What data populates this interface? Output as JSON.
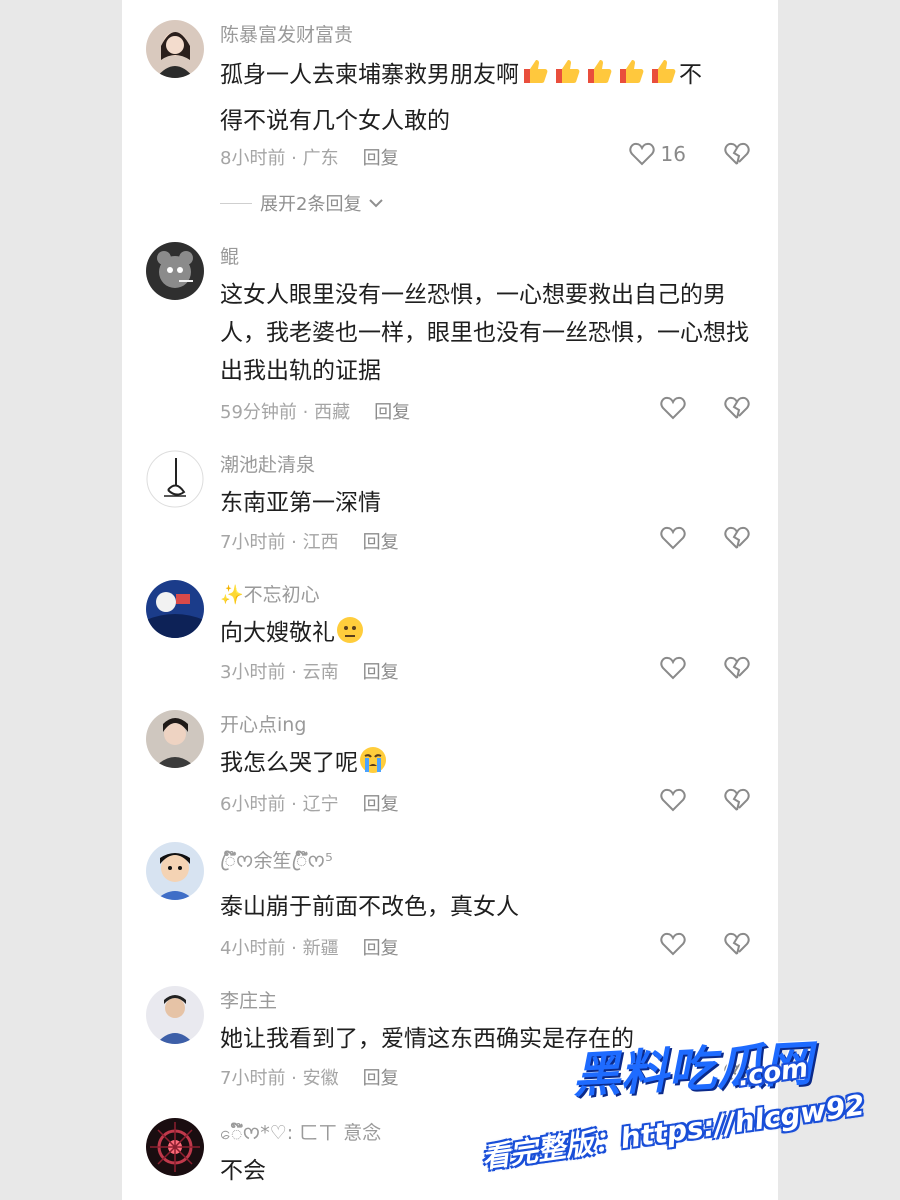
{
  "comments": [
    {
      "username": "陈暴富发财富贵",
      "text_lines": [
        "孤身一人去柬埔寨救男朋友啊",
        "不",
        "得不说有几个女人敢的"
      ],
      "emojis": [
        "thumbs-up",
        "thumbs-up",
        "thumbs-up",
        "thumbs-up",
        "thumbs-up"
      ],
      "time": "8小时前 · 广东",
      "reply_label": "回复",
      "likes": "16",
      "expand_label": "展开2条回复"
    },
    {
      "username": "鲲",
      "text": "这女人眼里没有一丝恐惧，一心想要救出自己的男人，我老婆也一样，眼里也没有一丝恐惧，一心想找出我出轨的证据",
      "time": "59分钟前 · 西藏",
      "reply_label": "回复"
    },
    {
      "username": "潮池赴清泉",
      "text": "东南亚第一深情",
      "time": "7小时前 · 江西",
      "reply_label": "回复"
    },
    {
      "username": "✨不忘初心",
      "text": "向大嫂敬礼",
      "emoji": "neutral-face",
      "time": "3小时前 · 云南",
      "reply_label": "回复"
    },
    {
      "username": "开心点ing",
      "text": "我怎么哭了呢",
      "emoji": "crying-face",
      "time": "6小时前 · 辽宁",
      "reply_label": "回复"
    },
    {
      "username": "ꦿ໌໊ᰔ余笙ꦿ໌໊ᰔ⁵",
      "text": "泰山崩于前面不改色，真女人",
      "time": "4小时前 · 新疆",
      "reply_label": "回复"
    },
    {
      "username": "李庄主",
      "text": "她让我看到了，爱情这东西确实是存在的",
      "time": "7小时前 · 安徽",
      "reply_label": "回复"
    },
    {
      "username": "ေ໌໊ᰔ*♡: ㄈㄒ 意念",
      "text": "不会"
    }
  ],
  "watermark": {
    "brand": "黑料吃瓜网",
    "domain": ".com",
    "url_line": "看完整版：https://hlcgw92"
  },
  "colors": {
    "like_icon": "#8a8a8a",
    "text": "#1f1f1f",
    "meta": "#a5a5a5",
    "watermark_blue": "#1e6bff"
  }
}
